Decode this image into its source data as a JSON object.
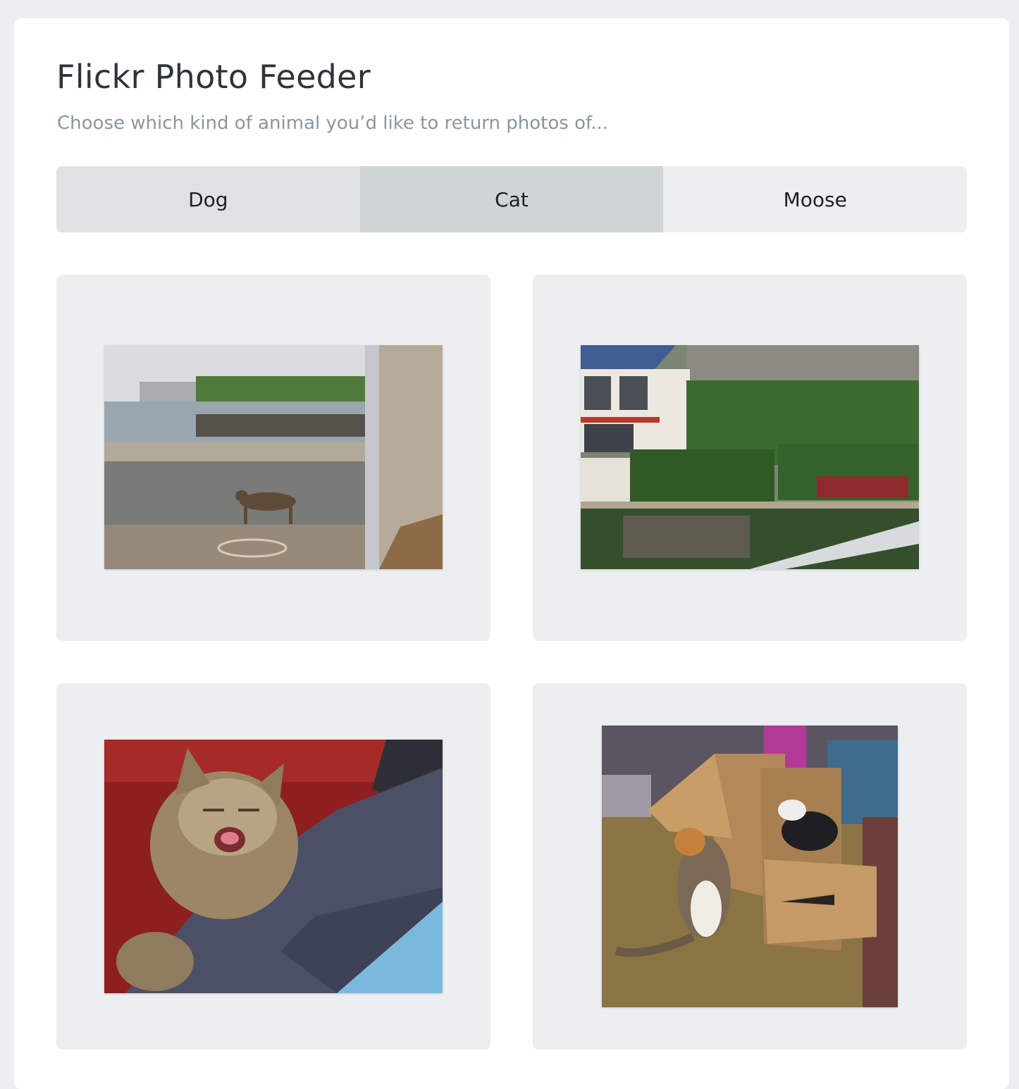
{
  "header": {
    "title": "Flickr Photo Feeder",
    "subtitle": "Choose which kind of animal you’d like to return photos of..."
  },
  "tabs": [
    {
      "label": "Dog",
      "selected": false
    },
    {
      "label": "Cat",
      "selected": true
    },
    {
      "label": "Moose",
      "selected": false
    }
  ],
  "photos": [
    {
      "subject": "cat walking on harbour pier"
    },
    {
      "subject": "hillside houses with garden"
    },
    {
      "subject": "long-haired cat yawning on red blanket"
    },
    {
      "subject": "two cats playing with cardboard boxes"
    }
  ],
  "colors": {
    "page_bg": "#eceef0",
    "card_bg": "#ffffff",
    "title": "#2f343a",
    "subtitle": "#8a969f",
    "tab_selected": "#cfd4d7"
  }
}
